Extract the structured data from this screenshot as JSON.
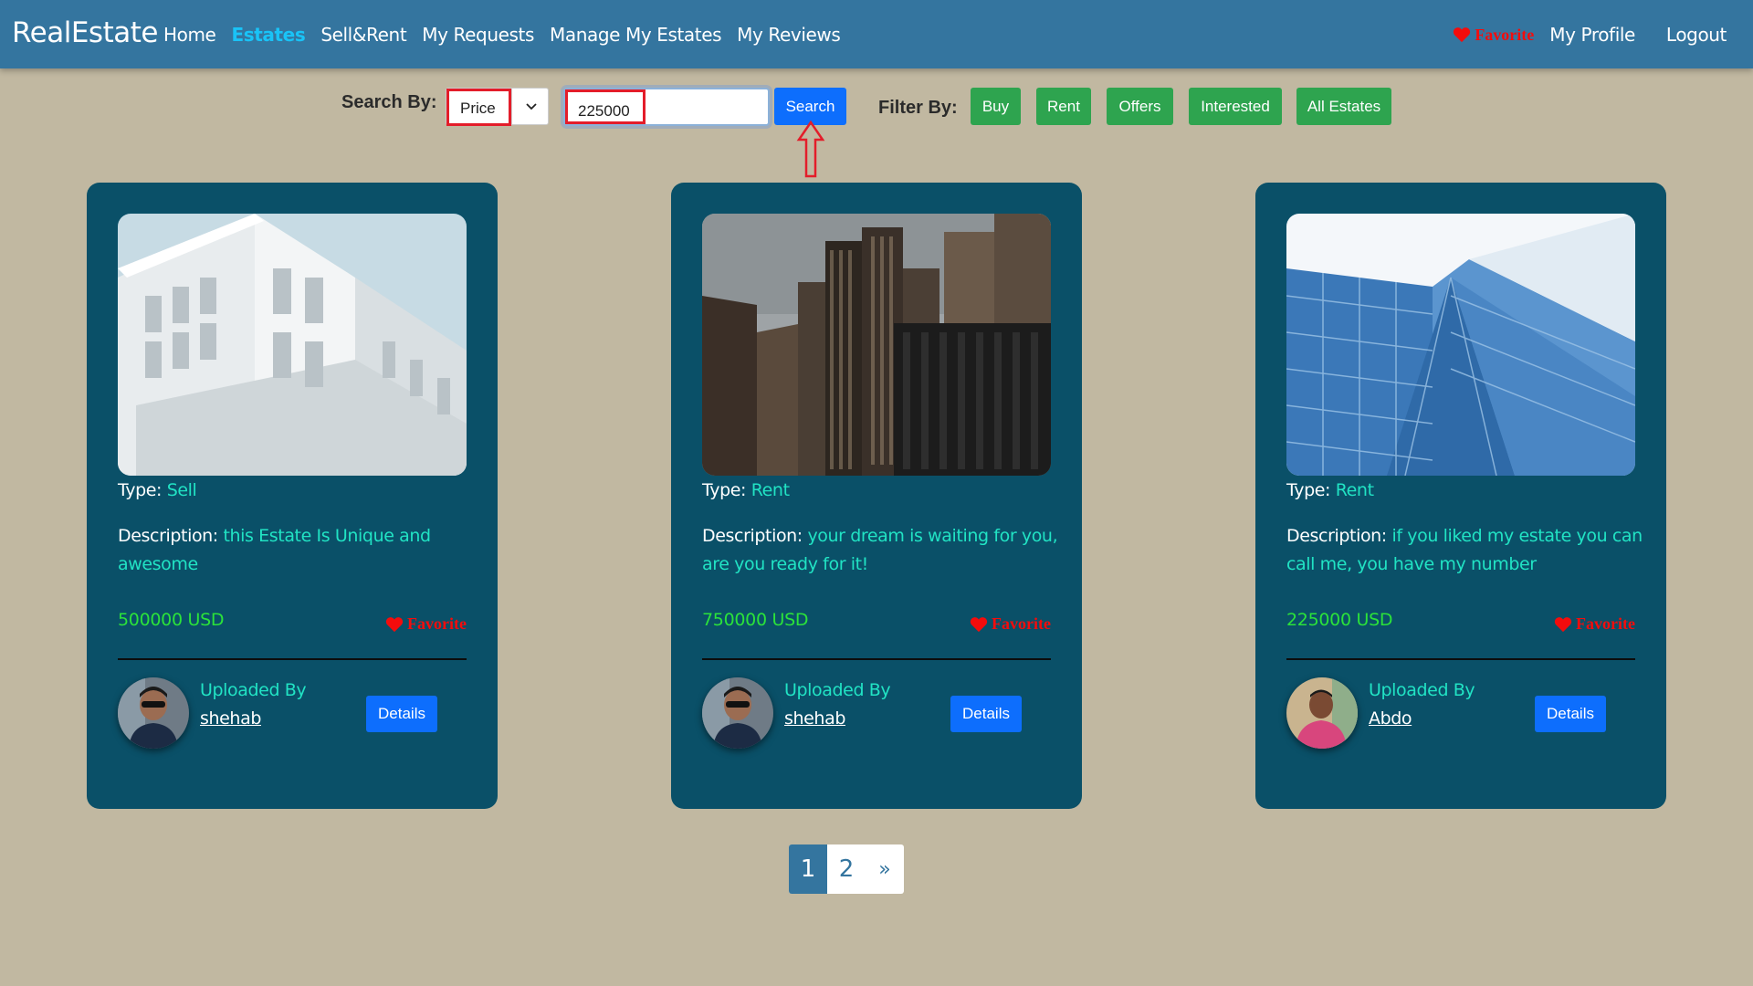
{
  "navbar": {
    "brand": "RealEstate",
    "links": [
      "Home",
      "Estates",
      "Sell&Rent",
      "My Requests",
      "Manage My Estates",
      "My Reviews"
    ],
    "favorite": "Favorite",
    "profile": "My Profile",
    "logout": "Logout"
  },
  "search": {
    "label": "Search By:",
    "select_value": "Price",
    "input_value": "225000",
    "button": "Search"
  },
  "filter": {
    "label": "Filter By:",
    "buttons": [
      "Buy",
      "Rent",
      "Offers",
      "Interested",
      "All Estates"
    ]
  },
  "colors": {
    "navbar": "#34759f",
    "page_bg": "#c1b8a1",
    "card_bg": "#0a5068",
    "accent_teal": "#21e3c4",
    "price_green": "#2be23a",
    "favorite_red": "#f40c0c",
    "button_blue": "#0d6efd",
    "filter_green": "#2ea44f",
    "highlight_red": "#e31d2a"
  },
  "cards": [
    {
      "type_label": "Type:",
      "type": "Sell",
      "desc_label": "Description:",
      "description": "this Estate Is Unique and awesome",
      "price": "500000 USD",
      "favorite": "Favorite",
      "uploaded_label": "Uploaded By",
      "uploader": "shehab",
      "details": "Details",
      "image": "white-modern-building-photo"
    },
    {
      "type_label": "Type:",
      "type": "Rent",
      "desc_label": "Description:",
      "description": "your dream is waiting for you, are you ready for it!",
      "price": "750000 USD",
      "favorite": "Favorite",
      "uploaded_label": "Uploaded By",
      "uploader": "shehab",
      "details": "Details",
      "image": "city-skyline-photo"
    },
    {
      "type_label": "Type:",
      "type": "Rent",
      "desc_label": "Description:",
      "description": "if you liked my estate you can call me, you have my number",
      "price": "225000 USD",
      "favorite": "Favorite",
      "uploaded_label": "Uploaded By",
      "uploader": "Abdo",
      "details": "Details",
      "image": "glass-skyscraper-photo"
    }
  ],
  "pagination": {
    "pages": [
      "1",
      "2"
    ],
    "next": "»",
    "current": 1
  }
}
